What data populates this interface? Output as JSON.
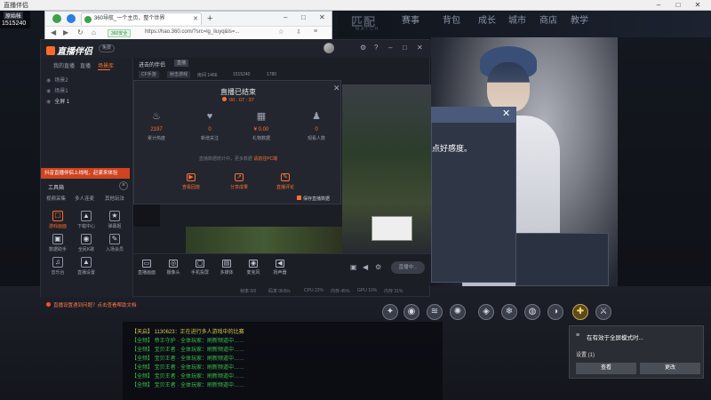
{
  "window": {
    "title": "直播伴侣",
    "min_icon": "minimize-icon",
    "max_icon": "maximize-icon",
    "close_icon": "close-icon"
  },
  "user_widget": {
    "name": "原始帐",
    "id": "1515240"
  },
  "browser": {
    "tab_title": "360导航_一个主页，整个世界",
    "url_badge": "360安全",
    "url": "https://hao.360.com/?src=lg_liuyq&ls=...",
    "url_full": "hao.360.com"
  },
  "game": {
    "logo": "匹配",
    "logo_sub": "MATCH",
    "tabs": [
      "赛事",
      "背包",
      "成长",
      "城市",
      "商店",
      "教学"
    ],
    "dialog_text": "点好感度。",
    "skills": [
      "✦",
      "◉",
      "≋",
      "✺",
      "◈",
      "❄",
      "◍",
      "◑",
      "✚",
      "⚔",
      "◐"
    ],
    "chat_lines": [
      "【天启】 1130623：正在进行多人游戏中的比赛",
      "【全频】 帝王守护 · 全体玩家：刷新频道中……",
      "【全频】 宝贝王者 · 全体玩家：刷新频道中……",
      "【全频】 宝贝王者 · 全体玩家：刷新频道中……",
      "【全频】 宝贝王者 · 全体玩家：刷新频道中……",
      "【全频】 宝贝王者 · 全体玩家：刷新频道中……",
      "【全频】 宝贝王者 · 全体玩家：刷新频道中……"
    ]
  },
  "app": {
    "logo": "直播伴侣",
    "free_tag": "免费",
    "left_tabs": [
      "我的直播",
      "直播",
      "场景库"
    ],
    "scenes": [
      "场景2",
      "场景1",
      "全屏 1"
    ],
    "promo": "抖音直播伴侣上线啦，赶紧来体验",
    "toolbox_label": "工具箱",
    "subtabs": [
      "视频采集",
      "多人连麦",
      "其他玩法"
    ],
    "tools": [
      {
        "icon": "☐",
        "label": "游戏画面"
      },
      {
        "icon": "▲",
        "label": "下载中心"
      },
      {
        "icon": "★",
        "label": "弹幕姬"
      },
      {
        "icon": "▣",
        "label": "数据助手"
      },
      {
        "icon": "◉",
        "label": "全民K歌"
      },
      {
        "icon": "✎",
        "label": "入场会员"
      },
      {
        "icon": "♫",
        "label": "音乐台"
      },
      {
        "icon": "▲",
        "label": "直播设置"
      }
    ],
    "notice": "直播设置遇到问题？点击查看帮助文档",
    "stream_title": "进击的伴侣",
    "stream_tag": "直播",
    "info_tags": [
      "CF手游",
      "射击游戏"
    ],
    "info_texts": [
      "房间 1466",
      "1515240",
      "1780"
    ],
    "bottom_tools": [
      {
        "icon": "▭",
        "label": "直播画面"
      },
      {
        "icon": "◎",
        "label": "摄像头"
      },
      {
        "icon": "▢",
        "label": "手机投屏"
      },
      {
        "icon": "▤",
        "label": "多媒体"
      },
      {
        "icon": "◉",
        "label": "麦克风"
      },
      {
        "icon": "◀",
        "label": "扬声器"
      }
    ],
    "go_live": "直播中...",
    "status": [
      "帧率 0/0",
      "码率 0KB/s",
      "CPU 22%",
      "内存 45%",
      "GPU 10%",
      "内存 31%"
    ]
  },
  "modal": {
    "title": "直播已结束",
    "duration": "00 : 07 : 37",
    "stats": [
      {
        "icon": "flame-icon",
        "value": "2197",
        "label": "累计热度"
      },
      {
        "icon": "heart-icon",
        "value": "0",
        "label": "新增关注"
      },
      {
        "icon": "gift-icon",
        "value": "¥ 0.00",
        "label": "礼物数据"
      },
      {
        "icon": "user-icon",
        "value": "0",
        "label": "观看人数"
      }
    ],
    "hint_prefix": "直播数据统计中，更多数据",
    "hint_link": "请前往PC端",
    "shares": [
      {
        "icon": "▶",
        "label": "查看回放"
      },
      {
        "icon": "↗",
        "label": "分享成果"
      },
      {
        "icon": "✎",
        "label": "直播评论"
      }
    ],
    "save_label": "保存直播数据"
  },
  "notification": {
    "title": "在有效于全屏模式时...",
    "setting": "设置 (1)",
    "btn_view": "查看",
    "btn_change": "更改"
  }
}
